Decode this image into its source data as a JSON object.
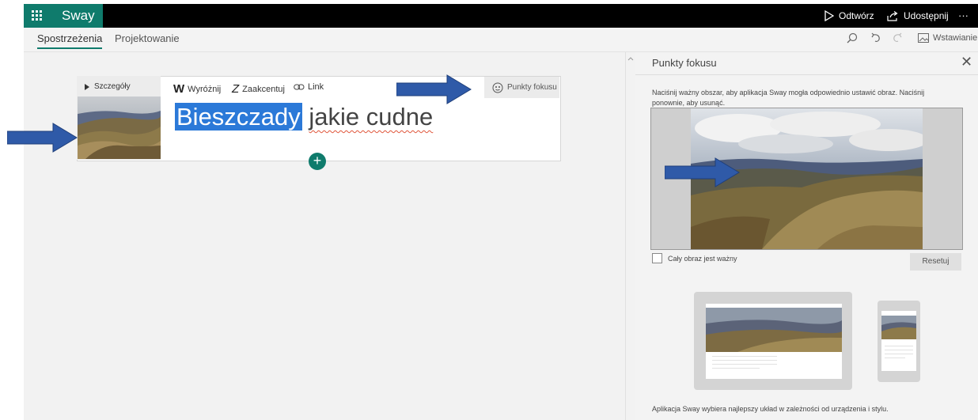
{
  "app": {
    "name": "Sway"
  },
  "topbar": {
    "play_label": "Odtwórz",
    "share_label": "Udostępnij",
    "more_label": "···"
  },
  "tabs": [
    {
      "label": "Spostrzeżenia"
    },
    {
      "label": "Projektowanie"
    }
  ],
  "toolbar": {
    "insert_label": "Wstawianie"
  },
  "card": {
    "details_label": "Szczegóły",
    "emphasize_label": "Wyróżnij",
    "accent_label": "Zaakcentuj",
    "link_label": "Link",
    "focus_label": "Punkty fokusu",
    "headline_selected": "Bieszczady",
    "headline_rest": "jakie cudne"
  },
  "panel": {
    "title": "Punkty fokusu",
    "description": "Naciśnij ważny obszar, aby aplikacja Sway mogła odpowiednio ustawić obraz. Naciśnij ponownie, aby usunąć.",
    "whole_image_label": "Cały obraz jest ważny",
    "reset_label": "Resetuj",
    "footer": "Aplikacja Sway wybiera najlepszy układ w zależności od urządzenia i stylu."
  },
  "colors": {
    "accent": "#0f7b6c",
    "selection": "#2b79d8",
    "arrow": "#2f5aa8"
  },
  "icons": [
    "waffle-icon",
    "play-icon",
    "share-icon",
    "search-icon",
    "undo-icon",
    "redo-icon",
    "image-icon",
    "caret-right-icon",
    "link-icon",
    "focus-icon",
    "close-icon",
    "plus-icon"
  ]
}
